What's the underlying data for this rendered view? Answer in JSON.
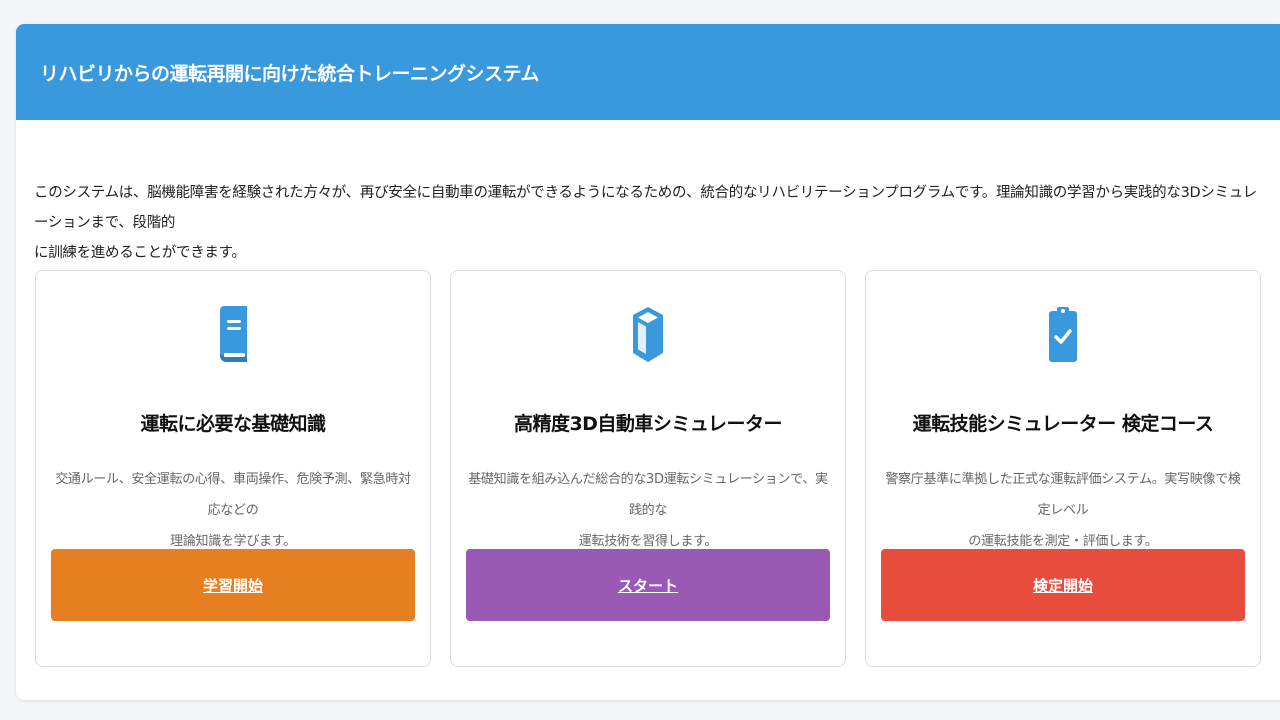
{
  "header": {
    "title": "リハビリからの運転再開に向けた統合トレーニングシステム"
  },
  "intro": {
    "line1": "このシステムは、脳機能障害を経験された方々が、再び安全に自動車の運転ができるようになるための、統合的なリハビリテーションプログラムです。理論知識の学習から実践的な3Dシミュレーションまで、段階的",
    "line2": "に訓練を進めることができます。"
  },
  "cards": [
    {
      "icon": "book-icon",
      "title": "運転に必要な基礎知識",
      "desc_line1": "交通ルール、安全運転の心得、車両操作、危険予測、緊急時対応などの",
      "desc_line2": "理論知識を学びます。",
      "button_label": "学習開始",
      "button_color": "#e67e22"
    },
    {
      "icon": "cube-icon",
      "title": "高精度3D自動車シミュレーター",
      "desc_line1": "基礎知識を組み込んだ総合的な3D運転シミュレーションで、実践的な",
      "desc_line2": "運転技術を習得します。",
      "button_label": "スタート",
      "button_color": "#9b59b6"
    },
    {
      "icon": "clipboard-check-icon",
      "title": "運転技能シミュレーター 検定コース",
      "desc_line1": "警察庁基準に準拠した正式な運転評価システム。実写映像で検定レベル",
      "desc_line2": "の運転技能を測定・評価します。",
      "button_label": "検定開始",
      "button_color": "#e74c3c"
    }
  ],
  "colors": {
    "header_bg": "#3a99dc",
    "icon": "#3a99dc"
  }
}
